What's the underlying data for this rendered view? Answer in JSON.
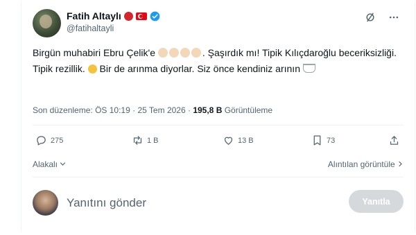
{
  "tweet": {
    "author": {
      "display_name": "Fatih Altaylı",
      "handle": "@fatihaltayli",
      "name_emojis": [
        "red-circle",
        "turkish-flag"
      ],
      "verified": true
    },
    "text": {
      "part1": "Birgün muhabiri Ebru Çelik'e",
      "part2": ". Şaşırdık mı! Tipik Kılıçdaroğlu beceriksizliği. Tipik rezillik.",
      "part3": "Bir de arınma diyorlar. Siz önce kendiniz arının"
    },
    "meta": {
      "edited_label": "Son düzenleme:",
      "time": "ÖS 10:19",
      "separator": "·",
      "date": "25 Tem 2026",
      "views_count": "195,8 B",
      "views_label": "Görüntüleme"
    },
    "actions": {
      "replies": "275",
      "retweets": "1 B",
      "likes": "13 B",
      "bookmarks": "73"
    },
    "related_label": "Alakalı",
    "quotes_label": "Alıntılan görüntüle",
    "reply_box": {
      "placeholder": "Yanıtını gönder",
      "button": "Yanıtla"
    }
  },
  "colors": {
    "text": "#0f1419",
    "muted": "#536471",
    "verified": "#1d9bf0",
    "reply_button_disabled": "#d6d9db"
  }
}
